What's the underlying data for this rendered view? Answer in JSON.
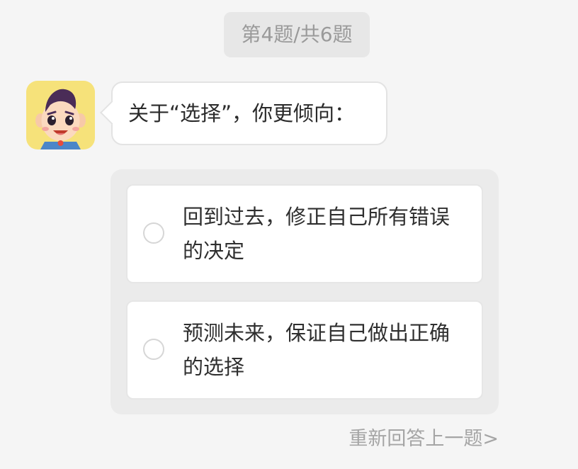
{
  "progress": {
    "text": "第4题/共6题"
  },
  "question": {
    "text": "关于“选择”，你更倾向："
  },
  "avatar": {
    "icon": "cartoon-boy-avatar-icon"
  },
  "options": [
    {
      "text": "回到过去，修正自己所有错误的决定"
    },
    {
      "text": "预测未来，保证自己做出正确的选择"
    }
  ],
  "footer": {
    "redo_label": "重新回答上一题>"
  },
  "colors": {
    "background": "#f5f5f5",
    "pill": "#e7e7e7",
    "panel": "#ebebeb",
    "avatar_bg": "#f6e27a"
  }
}
